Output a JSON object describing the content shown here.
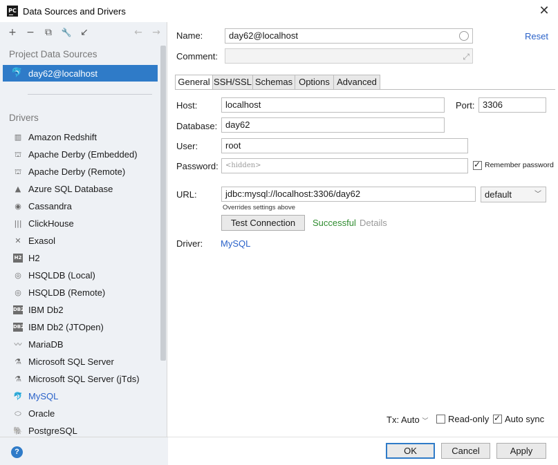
{
  "window": {
    "app_icon_label": "PC",
    "title": "Data Sources and Drivers",
    "close_glyph": "✕"
  },
  "toolbar": {
    "add": "+",
    "remove": "−",
    "duplicate": "⧉",
    "wrench": "🔧",
    "import": "↙",
    "back": "←",
    "forward": "→"
  },
  "sidebar": {
    "project_section_label": "Project Data Sources",
    "selected_source": "day62@localhost",
    "drivers_section_label": "Drivers",
    "drivers": [
      {
        "label": "Amazon Redshift",
        "icon": "▥",
        "box": false
      },
      {
        "label": "Apache Derby (Embedded)",
        "icon": "⛫",
        "box": false
      },
      {
        "label": "Apache Derby (Remote)",
        "icon": "⛫",
        "box": false
      },
      {
        "label": "Azure SQL Database",
        "icon": "▲",
        "box": false
      },
      {
        "label": "Cassandra",
        "icon": "◉",
        "box": false
      },
      {
        "label": "ClickHouse",
        "icon": "|||",
        "box": false
      },
      {
        "label": "Exasol",
        "icon": "✕",
        "box": false
      },
      {
        "label": "H2",
        "icon": "H2",
        "box": true
      },
      {
        "label": "HSQLDB (Local)",
        "icon": "◎",
        "box": false
      },
      {
        "label": "HSQLDB (Remote)",
        "icon": "◎",
        "box": false
      },
      {
        "label": "IBM Db2",
        "icon": "DB2",
        "box": true
      },
      {
        "label": "IBM Db2 (JTOpen)",
        "icon": "DB2",
        "box": true
      },
      {
        "label": "MariaDB",
        "icon": "〰",
        "box": false
      },
      {
        "label": "Microsoft SQL Server",
        "icon": "⚗",
        "box": false
      },
      {
        "label": "Microsoft SQL Server (jTds)",
        "icon": "⚗",
        "box": false
      },
      {
        "label": "MySQL",
        "icon": "🐬",
        "box": false,
        "active": true
      },
      {
        "label": "Oracle",
        "icon": "⬭",
        "box": false
      },
      {
        "label": "PostgreSQL",
        "icon": "🐘",
        "box": false
      }
    ]
  },
  "form": {
    "name_label": "Name:",
    "name_value": "day62@localhost",
    "reset_link": "Reset",
    "comment_label": "Comment:",
    "comment_value": "",
    "expand_glyph": "⤢",
    "tabs": [
      "General",
      "SSH/SSL",
      "Schemas",
      "Options",
      "Advanced"
    ],
    "active_tab": "General",
    "host_label": "Host:",
    "host_value": "localhost",
    "port_label": "Port:",
    "port_value": "3306",
    "database_label": "Database:",
    "database_value": "day62",
    "user_label": "User:",
    "user_value": "root",
    "password_label": "Password:",
    "password_placeholder": "<hidden>",
    "remember_password_label": "Remember password",
    "remember_password_checked": true,
    "url_label": "URL:",
    "url_value": "jdbc:mysql://localhost:3306/day62",
    "url_mode": "default",
    "url_hint": "Overrides settings above",
    "test_connection_button": "Test Connection",
    "test_status": "Successful",
    "details_link": "Details",
    "driver_label": "Driver:",
    "driver_value": "MySQL"
  },
  "bottom": {
    "tx_label": "Tx: Auto",
    "read_only_label": "Read-only",
    "read_only_checked": false,
    "auto_sync_label": "Auto sync",
    "auto_sync_checked": true,
    "help_glyph": "?",
    "ok_button": "OK",
    "cancel_button": "Cancel",
    "apply_button": "Apply"
  },
  "colors": {
    "accent": "#2f7bc8",
    "link": "#2a62c9",
    "success": "#2f8c2f",
    "sidebar_bg": "#eef1f5"
  }
}
